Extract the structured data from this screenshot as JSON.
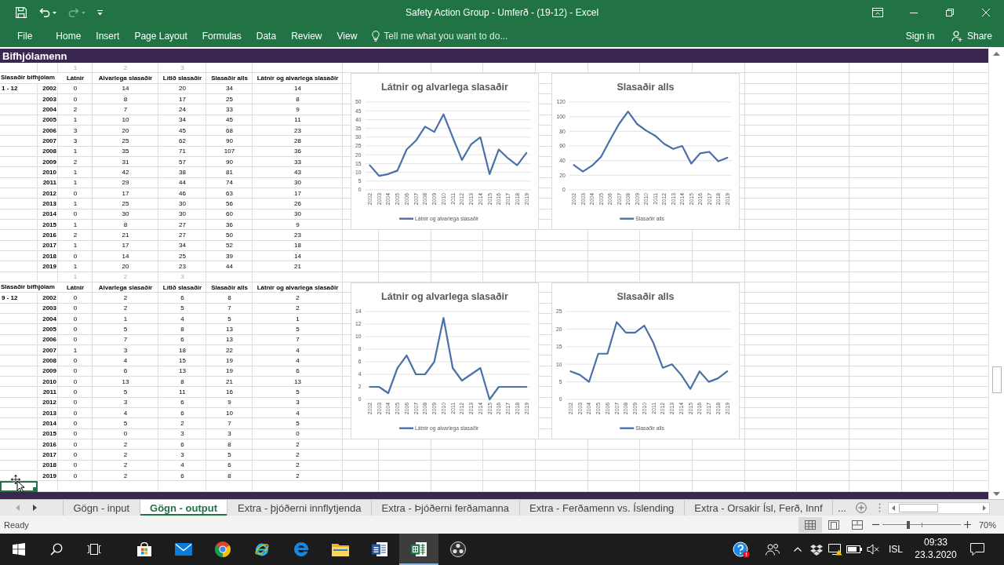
{
  "window": {
    "title": "Safety Action Group - Umferð - (19-12) - Excel",
    "quick_access": [
      {
        "disabled": false
      },
      {
        "disabled": false
      },
      {
        "disabled": true
      }
    ]
  },
  "ribbon": {
    "tabs": [
      {
        "label": "File",
        "selected": false
      },
      {
        "label": "Home",
        "selected": false
      },
      {
        "label": "Insert",
        "selected": false
      },
      {
        "label": "Page Layout",
        "selected": false
      },
      {
        "label": "Formulas",
        "selected": false
      },
      {
        "label": "Data",
        "selected": false
      },
      {
        "label": "Review",
        "selected": false
      },
      {
        "label": "View",
        "selected": false
      }
    ],
    "tell_me": {
      "placeholder": "Tell me what you want to do..."
    },
    "sign_in": "Sign in",
    "share": "Share"
  },
  "sheet": {
    "section_title": "Bifhjólamenn",
    "tables": [
      {
        "column_numbers": [
          "1",
          "2",
          "3"
        ],
        "columns": [
          "Slasaðir bifhjólam",
          "Látnir",
          "Alvarlega slasaðir",
          "Lítið slasaðir",
          "Slasaðir alls",
          "Látnir og alvarlega slasaðir"
        ],
        "period": "1 - 12",
        "rows": [
          [
            "2002",
            "0",
            "14",
            "20",
            "34",
            "14"
          ],
          [
            "2003",
            "0",
            "8",
            "17",
            "25",
            "8"
          ],
          [
            "2004",
            "2",
            "7",
            "24",
            "33",
            "9"
          ],
          [
            "2005",
            "1",
            "10",
            "34",
            "45",
            "11"
          ],
          [
            "2006",
            "3",
            "20",
            "45",
            "68",
            "23"
          ],
          [
            "2007",
            "3",
            "25",
            "62",
            "90",
            "28"
          ],
          [
            "2008",
            "1",
            "35",
            "71",
            "107",
            "36"
          ],
          [
            "2009",
            "2",
            "31",
            "57",
            "90",
            "33"
          ],
          [
            "2010",
            "1",
            "42",
            "38",
            "81",
            "43"
          ],
          [
            "2011",
            "1",
            "29",
            "44",
            "74",
            "30"
          ],
          [
            "2012",
            "0",
            "17",
            "46",
            "63",
            "17"
          ],
          [
            "2013",
            "1",
            "25",
            "30",
            "56",
            "26"
          ],
          [
            "2014",
            "0",
            "30",
            "30",
            "60",
            "30"
          ],
          [
            "2015",
            "1",
            "8",
            "27",
            "36",
            "9"
          ],
          [
            "2016",
            "2",
            "21",
            "27",
            "50",
            "23"
          ],
          [
            "2017",
            "1",
            "17",
            "34",
            "52",
            "18"
          ],
          [
            "2018",
            "0",
            "14",
            "25",
            "39",
            "14"
          ],
          [
            "2019",
            "1",
            "20",
            "23",
            "44",
            "21"
          ]
        ],
        "charts": [
          {
            "chart_data": {
              "type": "line",
              "title": "Látnir og alvarlega slasaðir",
              "categories": [
                "2002",
                "2003",
                "2004",
                "2005",
                "2006",
                "2007",
                "2008",
                "2009",
                "2010",
                "2011",
                "2012",
                "2013",
                "2014",
                "2015",
                "2016",
                "2017",
                "2018",
                "2019"
              ],
              "series": [
                {
                  "name": "Látnir og alvarlega slasaðir",
                  "color": "#4a70a8",
                  "values": [
                    14,
                    8,
                    9,
                    11,
                    23,
                    28,
                    36,
                    33,
                    43,
                    30,
                    17,
                    26,
                    30,
                    9,
                    23,
                    18,
                    14,
                    21
                  ]
                }
              ],
              "ylim": [
                0,
                50
              ],
              "yticks": [
                0,
                5,
                10,
                15,
                20,
                25,
                30,
                35,
                40,
                45,
                50
              ],
              "grid": true
            }
          },
          {
            "chart_data": {
              "type": "line",
              "title": "Slasaðir alls",
              "categories": [
                "2002",
                "2003",
                "2004",
                "2005",
                "2006",
                "2007",
                "2008",
                "2009",
                "2010",
                "2011",
                "2012",
                "2013",
                "2014",
                "2015",
                "2016",
                "2017",
                "2018",
                "2019"
              ],
              "series": [
                {
                  "name": "Slasaðir alls",
                  "color": "#4a70a8",
                  "values": [
                    34,
                    25,
                    33,
                    45,
                    68,
                    90,
                    107,
                    90,
                    81,
                    74,
                    63,
                    56,
                    60,
                    36,
                    50,
                    52,
                    39,
                    44
                  ]
                }
              ],
              "ylim": [
                0,
                120
              ],
              "yticks": [
                0,
                20,
                40,
                60,
                80,
                100,
                120
              ],
              "grid": true
            }
          }
        ]
      },
      {
        "column_numbers": [
          "1",
          "2",
          "3"
        ],
        "columns": [
          "Slasaðir bifhjólam",
          "Látnir",
          "Alvarlega slasaðir",
          "Lítið slasaðir",
          "Slasaðir alls",
          "Látnir og alvarlega slasaðir"
        ],
        "period": "9 - 12",
        "rows": [
          [
            "2002",
            "0",
            "2",
            "6",
            "8",
            "2"
          ],
          [
            "2003",
            "0",
            "2",
            "5",
            "7",
            "2"
          ],
          [
            "2004",
            "0",
            "1",
            "4",
            "5",
            "1"
          ],
          [
            "2005",
            "0",
            "5",
            "8",
            "13",
            "5"
          ],
          [
            "2006",
            "0",
            "7",
            "6",
            "13",
            "7"
          ],
          [
            "2007",
            "1",
            "3",
            "18",
            "22",
            "4"
          ],
          [
            "2008",
            "0",
            "4",
            "15",
            "19",
            "4"
          ],
          [
            "2009",
            "0",
            "6",
            "13",
            "19",
            "6"
          ],
          [
            "2010",
            "0",
            "13",
            "8",
            "21",
            "13"
          ],
          [
            "2011",
            "0",
            "5",
            "11",
            "16",
            "5"
          ],
          [
            "2012",
            "0",
            "3",
            "6",
            "9",
            "3"
          ],
          [
            "2013",
            "0",
            "4",
            "6",
            "10",
            "4"
          ],
          [
            "2014",
            "0",
            "5",
            "2",
            "7",
            "5"
          ],
          [
            "2015",
            "0",
            "0",
            "3",
            "3",
            "0"
          ],
          [
            "2016",
            "0",
            "2",
            "6",
            "8",
            "2"
          ],
          [
            "2017",
            "0",
            "2",
            "3",
            "5",
            "2"
          ],
          [
            "2018",
            "0",
            "2",
            "4",
            "6",
            "2"
          ],
          [
            "2019",
            "0",
            "2",
            "6",
            "8",
            "2"
          ]
        ],
        "charts": [
          {
            "chart_data": {
              "type": "line",
              "title": "Látnir og alvarlega slasaðir",
              "categories": [
                "2002",
                "2003",
                "2004",
                "2005",
                "2006",
                "2007",
                "2008",
                "2009",
                "2010",
                "2011",
                "2012",
                "2013",
                "2014",
                "2015",
                "2016",
                "2017",
                "2018",
                "2019"
              ],
              "series": [
                {
                  "name": "Látnir og alvarlega slasaðir",
                  "color": "#4a70a8",
                  "values": [
                    2,
                    2,
                    1,
                    5,
                    7,
                    4,
                    4,
                    6,
                    13,
                    5,
                    3,
                    4,
                    5,
                    0,
                    2,
                    2,
                    2,
                    2
                  ]
                }
              ],
              "ylim": [
                0,
                14
              ],
              "yticks": [
                0,
                2,
                4,
                6,
                8,
                10,
                12,
                14
              ],
              "grid": true
            }
          },
          {
            "chart_data": {
              "type": "line",
              "title": "Slasaðir alls",
              "categories": [
                "2002",
                "2003",
                "2004",
                "2005",
                "2006",
                "2007",
                "2008",
                "2009",
                "2010",
                "2011",
                "2012",
                "2013",
                "2014",
                "2015",
                "2016",
                "2017",
                "2018",
                "2019"
              ],
              "series": [
                {
                  "name": "Slasaðir alls",
                  "color": "#4a70a8",
                  "values": [
                    8,
                    7,
                    5,
                    13,
                    13,
                    22,
                    19,
                    19,
                    21,
                    16,
                    9,
                    10,
                    7,
                    3,
                    8,
                    5,
                    6,
                    8
                  ]
                }
              ],
              "ylim": [
                0,
                25
              ],
              "yticks": [
                0,
                5,
                10,
                15,
                20,
                25
              ],
              "grid": true
            }
          }
        ]
      }
    ],
    "active_cell": {
      "selected": true
    }
  },
  "sheet_tabs": {
    "tabs": [
      {
        "label": "Gögn - input",
        "selected": false
      },
      {
        "label": "Gögn - output",
        "selected": true
      },
      {
        "label": "Extra - þjóðerni innflytjenda",
        "selected": false
      },
      {
        "label": "Extra - Þjóðerni ferðamanna",
        "selected": false
      },
      {
        "label": "Extra - Ferðamenn vs. Íslending",
        "selected": false
      },
      {
        "label": "Extra - Orsakir Ísl, Ferð, Innf",
        "selected": false
      }
    ],
    "more": "..."
  },
  "status_bar": {
    "text": "Ready",
    "views": [
      {
        "selected": true
      },
      {
        "selected": false
      },
      {
        "selected": false
      }
    ],
    "zoom_slider": {
      "level": 0.33
    },
    "zoom": "70%"
  },
  "taskbar": {
    "apps": [
      {
        "selected": false
      },
      {
        "selected": false
      },
      {
        "selected": false
      },
      {
        "selected": false
      },
      {
        "selected": false
      },
      {
        "selected": false
      },
      {
        "selected": false
      },
      {
        "selected": true
      },
      {
        "selected": false
      }
    ],
    "language": "ISL",
    "time": "09:33",
    "date": "23.3.2020"
  }
}
